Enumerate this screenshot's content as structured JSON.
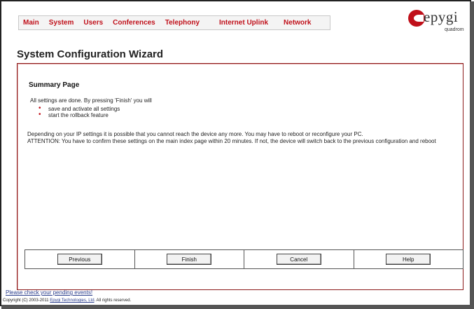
{
  "nav": {
    "items": [
      "Main",
      "System",
      "Users",
      "Conferences",
      "Telephony",
      "Internet Uplink",
      "Network"
    ]
  },
  "logo": {
    "brand": "epygi",
    "product": "quadrom"
  },
  "page_title": "System Configuration Wizard",
  "summary": {
    "title": "Summary Page",
    "intro": "All settings are done. By pressing 'Finish' you will",
    "bullets": [
      "save and activate all settings",
      "start the rollback feature"
    ],
    "note_line1": "Depending on your IP settings it is possible that you cannot reach the device any more. You may have to reboot or reconfigure your PC.",
    "note_line2": "ATTENTION: You have to confirm these settings on the main index page within 20 minutes. If not, the device will switch back to the previous configuration and reboot"
  },
  "buttons": {
    "previous": "Previous",
    "finish": "Finish",
    "cancel": "Cancel",
    "help": "Help"
  },
  "footer": {
    "events_link": "Please check your pending events!",
    "copyright_prefix": "Copyright (C) 2003-2011 ",
    "company_link": "Epygi Technologies, Ltd",
    "copyright_suffix": ". All rights reserved."
  },
  "colors": {
    "accent": "#c0101a",
    "panel_border": "#8b1a1a",
    "link": "#2b3e8c"
  }
}
